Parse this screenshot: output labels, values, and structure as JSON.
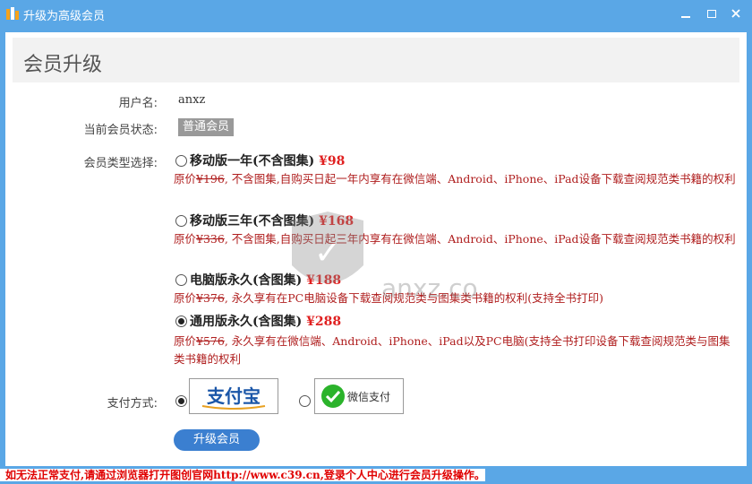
{
  "window": {
    "title": "升级为高级会员"
  },
  "panel": {
    "title": "会员升级"
  },
  "user": {
    "label": "用户名:",
    "value": "anxz"
  },
  "status": {
    "label": "当前会员状态:",
    "value": "普通会员"
  },
  "type": {
    "label": "会员类型选择:",
    "options": [
      {
        "title": "移动版一年(不含图集)",
        "price": "¥98",
        "orig_label": "原价",
        "orig_price": "¥196",
        "desc": ", 不含图集,自购买日起一年内享有在微信端、Android、iPhone、iPad设备下载查阅规范类书籍的权利",
        "checked": false
      },
      {
        "title": "移动版三年(不含图集)",
        "price": "¥168",
        "orig_label": "原价",
        "orig_price": "¥336",
        "desc": ", 不含图集,自购买日起三年内享有在微信端、Android、iPhone、iPad设备下载查阅规范类书籍的权利",
        "checked": false
      },
      {
        "title": "电脑版永久(含图集)",
        "price": "¥188",
        "orig_label": "原价",
        "orig_price": "¥376",
        "desc": ", 永久享有在PC电脑设备下载查阅规范类与图集类书籍的权利(支持全书打印)",
        "checked": false
      },
      {
        "title": "通用版永久(含图集)",
        "price": "¥288",
        "orig_label": "原价",
        "orig_price": "¥576",
        "desc": ", 永久享有在微信端、Android、iPhone、iPad以及PC电脑(支持全书打印设备下载查阅规范类与图集类书籍的权利",
        "checked": true
      }
    ]
  },
  "payment": {
    "label": "支付方式:",
    "alipay": "支付宝",
    "wechat": "微信支付"
  },
  "upgrade_button": "升级会员",
  "footer": "如无法正常支付,请通过浏览器打开图创官网http://www.c39.cn,登录个人中心进行会员升级操作。",
  "watermark": {
    "text": "anxz.com"
  },
  "colors": {
    "titlebar": "#5aa7e6",
    "price": "#e02020",
    "desc": "#b02020",
    "button": "#3b7fd0"
  }
}
